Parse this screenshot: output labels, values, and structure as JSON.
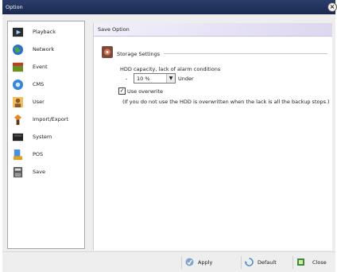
{
  "window": {
    "title": "Option"
  },
  "sidebar": {
    "items": [
      {
        "label": "Playback",
        "icon": "playback-icon"
      },
      {
        "label": "Network",
        "icon": "network-globe-icon"
      },
      {
        "label": "Event",
        "icon": "event-icon"
      },
      {
        "label": "CMS",
        "icon": "cms-icon"
      },
      {
        "label": "User",
        "icon": "user-icon"
      },
      {
        "label": "Import/Export",
        "icon": "import-export-icon"
      },
      {
        "label": "System",
        "icon": "system-icon"
      },
      {
        "label": "POS",
        "icon": "pos-icon"
      },
      {
        "label": "Save",
        "icon": "save-icon"
      }
    ]
  },
  "content": {
    "header": "Save Option",
    "section_title": "Storage Settings",
    "hdd_label": "HDD capacity, lack of alarm conditions",
    "dash": "-",
    "percent_value": "10 %",
    "under_label": "Under",
    "overwrite_label": "Use overwrite",
    "overwrite_checked": true,
    "note": "(If you do not use the HDD is overwritten when the lack is all the backup stops.)"
  },
  "footer": {
    "apply": "Apply",
    "default": "Default",
    "close": "Close"
  }
}
